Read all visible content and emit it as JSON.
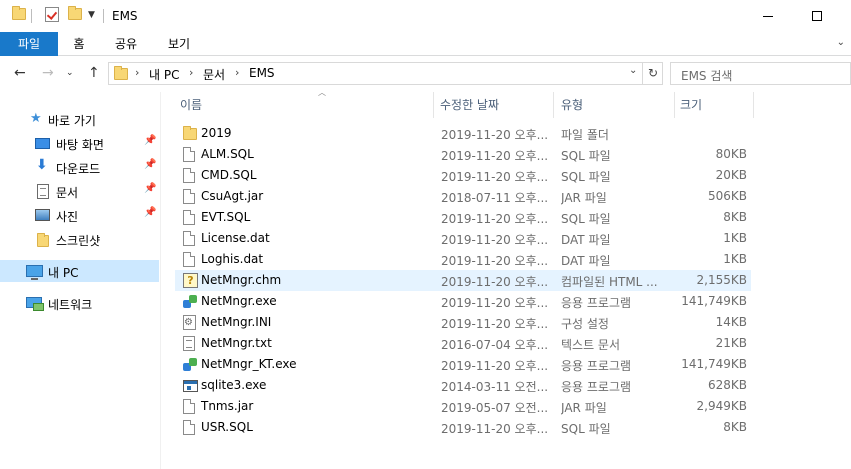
{
  "window": {
    "title": "EMS"
  },
  "ribbon": {
    "tabs": [
      "파일",
      "홈",
      "공유",
      "보기"
    ],
    "expand_icon": "chevron-down-icon"
  },
  "address": {
    "crumbs": [
      "내 PC",
      "문서",
      "EMS"
    ],
    "search_placeholder": "EMS 검색"
  },
  "nav": {
    "quick_access": "바로 가기",
    "items": [
      {
        "label": "바탕 화면",
        "icon": "desktop-icon",
        "pinned": true
      },
      {
        "label": "다운로드",
        "icon": "download-icon",
        "pinned": true
      },
      {
        "label": "문서",
        "icon": "documents-icon",
        "pinned": true
      },
      {
        "label": "사진",
        "icon": "pictures-icon",
        "pinned": true
      },
      {
        "label": "스크린샷",
        "icon": "folder-icon",
        "pinned": false
      }
    ],
    "this_pc": "내 PC",
    "network": "네트워크"
  },
  "columns": {
    "name": "이름",
    "date": "수정한 날짜",
    "type": "유형",
    "size": "크기"
  },
  "files": [
    {
      "name": "2019",
      "date": "2019-11-20 오후...",
      "type": "파일 폴더",
      "size": "",
      "icon": "folder"
    },
    {
      "name": "ALM.SQL",
      "date": "2019-11-20 오후...",
      "type": "SQL 파일",
      "size": "80KB",
      "icon": "file"
    },
    {
      "name": "CMD.SQL",
      "date": "2019-11-20 오후...",
      "type": "SQL 파일",
      "size": "20KB",
      "icon": "file"
    },
    {
      "name": "CsuAgt.jar",
      "date": "2018-07-11 오후...",
      "type": "JAR 파일",
      "size": "506KB",
      "icon": "file"
    },
    {
      "name": "EVT.SQL",
      "date": "2019-11-20 오후...",
      "type": "SQL 파일",
      "size": "8KB",
      "icon": "file"
    },
    {
      "name": "License.dat",
      "date": "2019-11-20 오후...",
      "type": "DAT 파일",
      "size": "1KB",
      "icon": "file"
    },
    {
      "name": "Loghis.dat",
      "date": "2019-11-20 오후...",
      "type": "DAT 파일",
      "size": "1KB",
      "icon": "file"
    },
    {
      "name": "NetMngr.chm",
      "date": "2019-11-20 오후...",
      "type": "컴파일된 HTML ...",
      "size": "2,155KB",
      "icon": "chm"
    },
    {
      "name": "NetMngr.exe",
      "date": "2019-11-20 오후...",
      "type": "응용 프로그램",
      "size": "141,749KB",
      "icon": "exe"
    },
    {
      "name": "NetMngr.INI",
      "date": "2019-11-20 오후...",
      "type": "구성 설정",
      "size": "14KB",
      "icon": "ini"
    },
    {
      "name": "NetMngr.txt",
      "date": "2016-07-04 오후...",
      "type": "텍스트 문서",
      "size": "21KB",
      "icon": "txt"
    },
    {
      "name": "NetMngr_KT.exe",
      "date": "2019-11-20 오후...",
      "type": "응용 프로그램",
      "size": "141,749KB",
      "icon": "exe"
    },
    {
      "name": "sqlite3.exe",
      "date": "2014-03-11 오전...",
      "type": "응용 프로그램",
      "size": "628KB",
      "icon": "sqlite"
    },
    {
      "name": "Tnms.jar",
      "date": "2019-05-07 오전...",
      "type": "JAR 파일",
      "size": "2,949KB",
      "icon": "file"
    },
    {
      "name": "USR.SQL",
      "date": "2019-11-20 오후...",
      "type": "SQL 파일",
      "size": "8KB",
      "icon": "file"
    }
  ],
  "colors": {
    "accent": "#1979ca",
    "selected": "#cce8ff",
    "hover": "#e5f3ff",
    "folder": "#f8d775"
  }
}
